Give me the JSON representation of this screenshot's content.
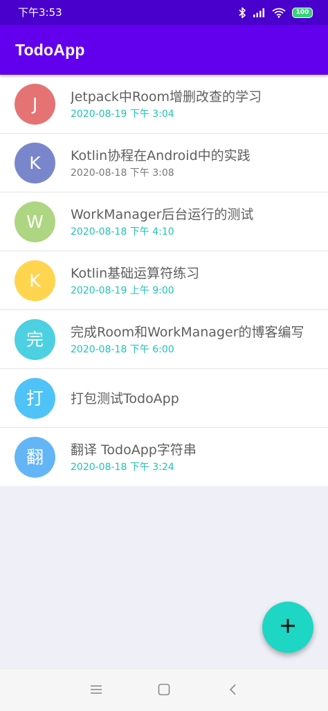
{
  "status_bar": {
    "time": "下午3:53",
    "battery": "100",
    "icons": [
      "bluetooth-icon",
      "signal-icon",
      "wifi-icon",
      "battery-icon"
    ]
  },
  "app_bar": {
    "title": "TodoApp"
  },
  "colors": {
    "status_bar": "#4a00cc",
    "app_bar": "#6200ee",
    "fab": "#1dd6c4",
    "time_accent": "#1ec3b8",
    "time_gray": "#777777",
    "title_text": "#5e5e5e",
    "background": "#efeff8"
  },
  "todos": [
    {
      "letter": "J",
      "avatar_color": "#e57373",
      "title": "Jetpack中Room增删改查的学习",
      "time": "2020-08-19  下午 3:04",
      "time_color": "#1ec3b8"
    },
    {
      "letter": "K",
      "avatar_color": "#7986cb",
      "title": "Kotlin协程在Android中的实践",
      "time": "2020-08-18  下午 3:08",
      "time_color": "#777777"
    },
    {
      "letter": "W",
      "avatar_color": "#aed581",
      "title": "WorkManager后台运行的测试",
      "time": "2020-08-18  下午 4:10",
      "time_color": "#1ec3b8"
    },
    {
      "letter": "K",
      "avatar_color": "#ffd54f",
      "title": "Kotlin基础运算符练习",
      "time": "2020-08-19  上午 9:00",
      "time_color": "#1ec3b8"
    },
    {
      "letter": "完",
      "avatar_color": "#4dd0e1",
      "title": "完成Room和WorkManager的博客编写",
      "time": "2020-08-18  下午 6:00",
      "time_color": "#1ec3b8"
    },
    {
      "letter": "打",
      "avatar_color": "#4fc3f7",
      "title": "打包测试TodoApp",
      "time": "",
      "time_color": "#1ec3b8"
    },
    {
      "letter": "翻",
      "avatar_color": "#64b5f6",
      "title": "翻译 TodoApp字符串",
      "time": "2020-08-18  下午 3:24",
      "time_color": "#1ec3b8"
    }
  ],
  "fab": {
    "icon": "plus-icon"
  },
  "nav_bar": {
    "buttons": [
      "menu-icon",
      "home-square-icon",
      "back-chevron-icon"
    ]
  }
}
